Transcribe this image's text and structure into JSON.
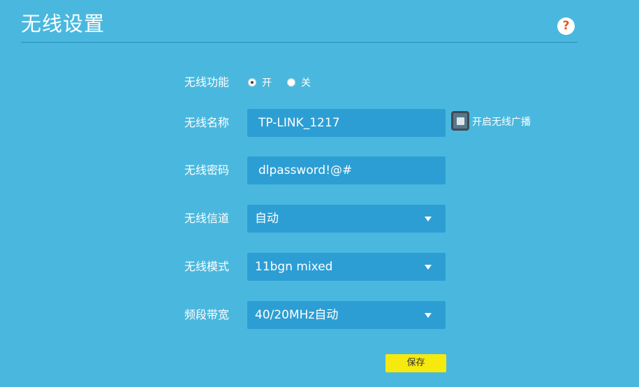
{
  "page": {
    "title": "无线设置",
    "help_icon": "?"
  },
  "wireless_function": {
    "label": "无线功能",
    "options": [
      "开",
      "关"
    ],
    "selected": "开"
  },
  "wireless_name": {
    "label": "无线名称",
    "value": "TP-LINK_1217"
  },
  "broadcast": {
    "label": "开启无线广播",
    "checked": false
  },
  "wireless_password": {
    "label": "无线密码",
    "value": "dlpassword!@#"
  },
  "wireless_channel": {
    "label": "无线信道",
    "value": "自动"
  },
  "wireless_mode": {
    "label": "无线模式",
    "value": "11bgn mixed"
  },
  "bandwidth": {
    "label": "频段带宽",
    "value": "40/20MHz自动"
  },
  "actions": {
    "save_label": "保存"
  },
  "colors": {
    "background": "#4ab8de",
    "field": "#2c9ed4",
    "save_button": "#f6e90e",
    "help_icon_mark": "#ee5418"
  },
  "icons": {
    "help": "question-mark-circle-icon",
    "dropdown": "caret-down-icon"
  }
}
